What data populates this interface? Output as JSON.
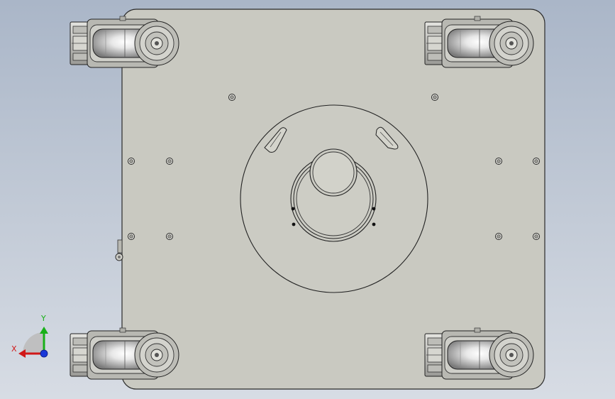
{
  "viewport": {
    "background_top": "#aab6c8",
    "background_bottom": "#d7dce4"
  },
  "model": {
    "plate_color": "#c9c9c1",
    "edge_color": "#2a2a2a",
    "caster_count": 4,
    "small_hole_count": 10
  },
  "triad": {
    "x_label": "X",
    "y_label": "Y",
    "x_color": "#d01818",
    "y_color": "#18b018",
    "z_color": "#1838d8"
  }
}
